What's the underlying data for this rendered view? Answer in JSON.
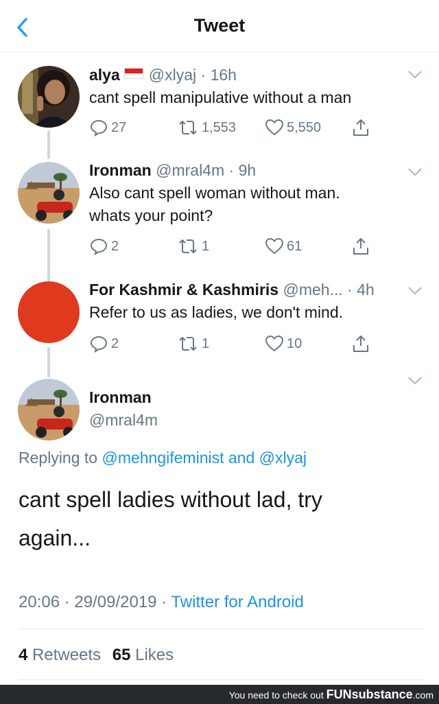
{
  "header": {
    "title": "Tweet"
  },
  "thread": [
    {
      "name": "alya",
      "handle": "@xlyaj",
      "time": "16h",
      "text": "cant spell manipulative without a man",
      "counts": {
        "replies": "27",
        "retweets": "1,553",
        "likes": "5,550"
      }
    },
    {
      "name": "Ironman",
      "handle": "@mral4m",
      "time": "9h",
      "text_line1": "Also cant spell woman without man.",
      "text_line2": "whats your point?",
      "counts": {
        "replies": "2",
        "retweets": "1",
        "likes": "61"
      }
    },
    {
      "name": "For Kashmir & Kashmiris",
      "handle": "@meh...",
      "time": "4h",
      "text": "Refer to us as ladies, we don't mind.",
      "avatar_color": "#e03a1e",
      "counts": {
        "replies": "2",
        "retweets": "1",
        "likes": "10"
      }
    }
  ],
  "main_tweet": {
    "name": "Ironman",
    "handle": "@mral4m",
    "replying_label": "Replying to",
    "replying_user1": "@mehngifeminist",
    "replying_and": "and",
    "replying_user2": "@xlyaj",
    "text_line1": "cant spell ladies without lad, try",
    "text_line2": "again...",
    "time": "20:06",
    "date": "29/09/2019",
    "source": "Twitter for Android",
    "retweets_count": "4",
    "retweets_label": "Retweets",
    "likes_count": "65",
    "likes_label": "Likes"
  },
  "watermark": {
    "prefix": "You need to check out",
    "brand": "FUNsubstance",
    "suffix": ".com"
  },
  "colors": {
    "link": "#1b95e0",
    "secondary": "#657786",
    "text": "#14171a",
    "flag_red": "#e02020"
  }
}
